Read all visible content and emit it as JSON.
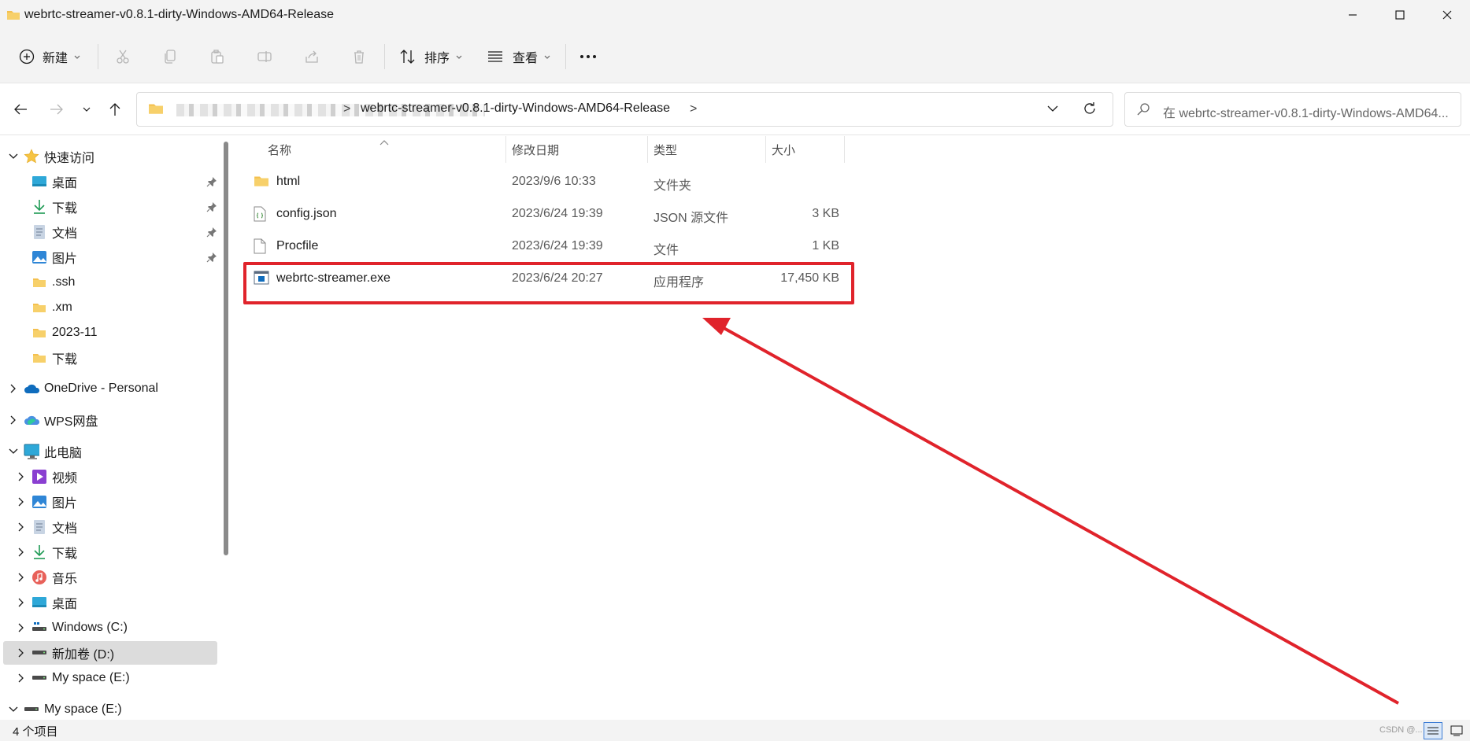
{
  "window": {
    "title": "webrtc-streamer-v0.8.1-dirty-Windows-AMD64-Release"
  },
  "toolbar": {
    "new_label": "新建",
    "sort_label": "排序",
    "view_label": "查看",
    "more_label": "···"
  },
  "address": {
    "current_folder": "webrtc-streamer-v0.8.1-dirty-Windows-AMD64-Release",
    "separator": ">",
    "trailing_separator": ">"
  },
  "search": {
    "placeholder": "在 webrtc-streamer-v0.8.1-dirty-Windows-AMD64..."
  },
  "sidebar": {
    "quick_access": {
      "label": "快速访问",
      "items": [
        {
          "label": "桌面",
          "icon": "desktop-icon",
          "pinned": true
        },
        {
          "label": "下载",
          "icon": "download-icon",
          "pinned": true
        },
        {
          "label": "文档",
          "icon": "document-icon",
          "pinned": true
        },
        {
          "label": "图片",
          "icon": "picture-icon",
          "pinned": true
        },
        {
          "label": ".ssh",
          "icon": "folder-icon",
          "pinned": false
        },
        {
          "label": ".xm",
          "icon": "folder-icon",
          "pinned": false
        },
        {
          "label": "2023-11",
          "icon": "folder-icon",
          "pinned": false
        },
        {
          "label": "下载",
          "icon": "folder-icon",
          "pinned": false
        }
      ]
    },
    "onedrive": {
      "label": "OneDrive - Personal"
    },
    "wps": {
      "label": "WPS网盘"
    },
    "this_pc": {
      "label": "此电脑",
      "items": [
        {
          "label": "视频",
          "icon": "video-icon"
        },
        {
          "label": "图片",
          "icon": "picture-icon"
        },
        {
          "label": "文档",
          "icon": "document-icon"
        },
        {
          "label": "下载",
          "icon": "download-icon"
        },
        {
          "label": "音乐",
          "icon": "music-icon"
        },
        {
          "label": "桌面",
          "icon": "desktop-icon"
        },
        {
          "label": "Windows (C:)",
          "icon": "drive-icon"
        },
        {
          "label": "新加卷 (D:)",
          "icon": "drive-icon",
          "selected": true
        },
        {
          "label": "My space (E:)",
          "icon": "drive-icon"
        }
      ]
    },
    "my_space": {
      "label": "My space (E:)"
    }
  },
  "columns": {
    "name": "名称",
    "date": "修改日期",
    "type": "类型",
    "size": "大小"
  },
  "files": [
    {
      "name": "html",
      "date": "2023/9/6 10:33",
      "type": "文件夹",
      "size": "",
      "icon": "folder-icon"
    },
    {
      "name": "config.json",
      "date": "2023/6/24 19:39",
      "type": "JSON 源文件",
      "size": "3 KB",
      "icon": "json-file-icon"
    },
    {
      "name": "Procfile",
      "date": "2023/6/24 19:39",
      "type": "文件",
      "size": "1 KB",
      "icon": "file-icon"
    },
    {
      "name": "webrtc-streamer.exe",
      "date": "2023/6/24 20:27",
      "type": "应用程序",
      "size": "17,450 KB",
      "icon": "exe-icon"
    }
  ],
  "status": {
    "item_count": "4 个项目",
    "watermark": "CSDN @..."
  },
  "colors": {
    "annotation_red": "#e0232b",
    "folder_yellow": "#f4c04f",
    "accent_blue": "#0067c0"
  }
}
